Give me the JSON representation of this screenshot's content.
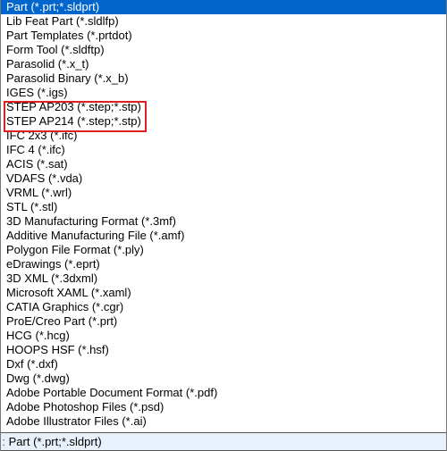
{
  "dropdown": {
    "options": [
      "Part (*.prt;*.sldprt)",
      "Lib Feat Part (*.sldlfp)",
      "Part Templates (*.prtdot)",
      "Form Tool (*.sldftp)",
      "Parasolid (*.x_t)",
      "Parasolid Binary (*.x_b)",
      "IGES (*.igs)",
      "STEP AP203 (*.step;*.stp)",
      "STEP AP214 (*.step;*.stp)",
      "IFC 2x3 (*.ifc)",
      "IFC 4 (*.ifc)",
      "ACIS (*.sat)",
      "VDAFS (*.vda)",
      "VRML (*.wrl)",
      "STL (*.stl)",
      "3D Manufacturing Format (*.3mf)",
      "Additive Manufacturing File (*.amf)",
      "Polygon File Format (*.ply)",
      "eDrawings (*.eprt)",
      "3D XML (*.3dxml)",
      "Microsoft XAML (*.xaml)",
      "CATIA Graphics (*.cgr)",
      "ProE/Creo Part (*.prt)",
      "HCG (*.hcg)",
      "HOOPS HSF (*.hsf)",
      "Dxf (*.dxf)",
      "Dwg (*.dwg)",
      "Adobe Portable Document Format (*.pdf)",
      "Adobe Photoshop Files (*.psd)",
      "Adobe Illustrator Files (*.ai)"
    ],
    "selected_index": 0,
    "highlighted_indices": [
      7,
      8
    ],
    "current_value": "Part (*.prt;*.sldprt)"
  }
}
